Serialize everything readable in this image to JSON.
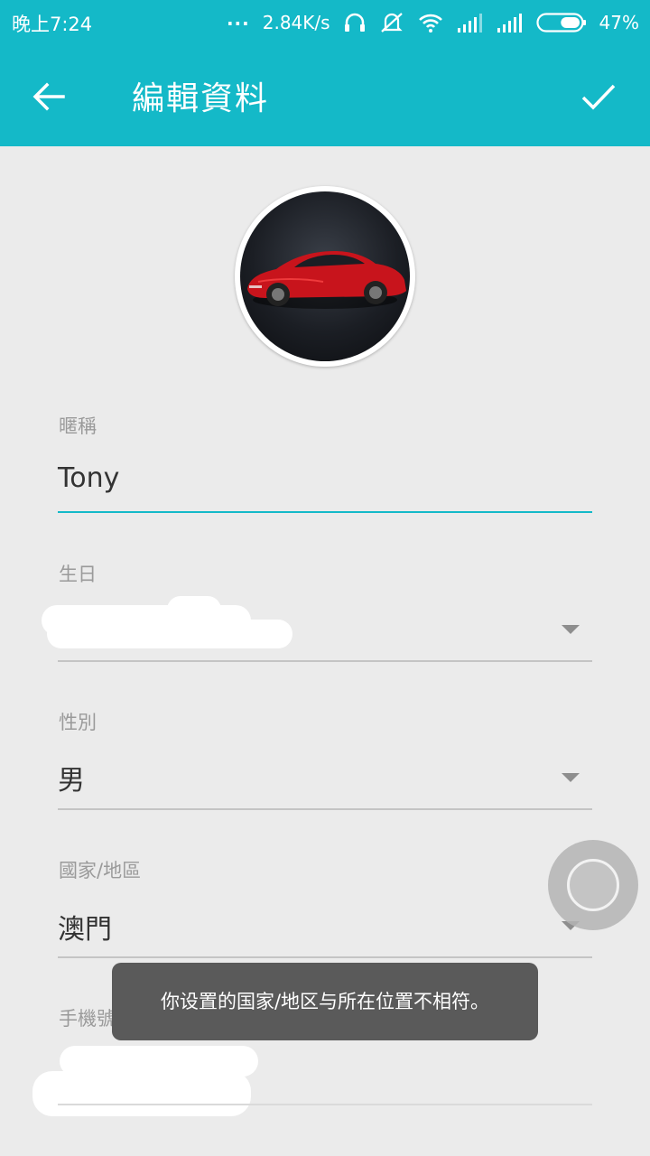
{
  "status_bar": {
    "time": "晚上7:24",
    "dots": "...",
    "network_speed": "2.84K/s",
    "battery_percent": "47%",
    "battery_level": 0.47,
    "icons": [
      "headset-icon",
      "silent-icon",
      "wifi-icon",
      "signal-icon",
      "signal-icon",
      "battery-icon"
    ]
  },
  "app_bar": {
    "title": "編輯資料",
    "back_icon": "arrow-left-icon",
    "confirm_icon": "check-icon"
  },
  "form": {
    "nickname": {
      "label": "暱稱",
      "value": "Tony"
    },
    "birthday": {
      "label": "生日",
      "value": ""
    },
    "gender": {
      "label": "性別",
      "value": "男"
    },
    "region": {
      "label": "國家/地區",
      "value": "澳門"
    },
    "phone": {
      "label": "手機號",
      "value": ""
    }
  },
  "toast": {
    "message": "你设置的国家/地区与所在位置不相符。"
  },
  "colors": {
    "primary": "#14b9c8",
    "background": "#ebebeb",
    "toast": "#5a5a5a"
  }
}
